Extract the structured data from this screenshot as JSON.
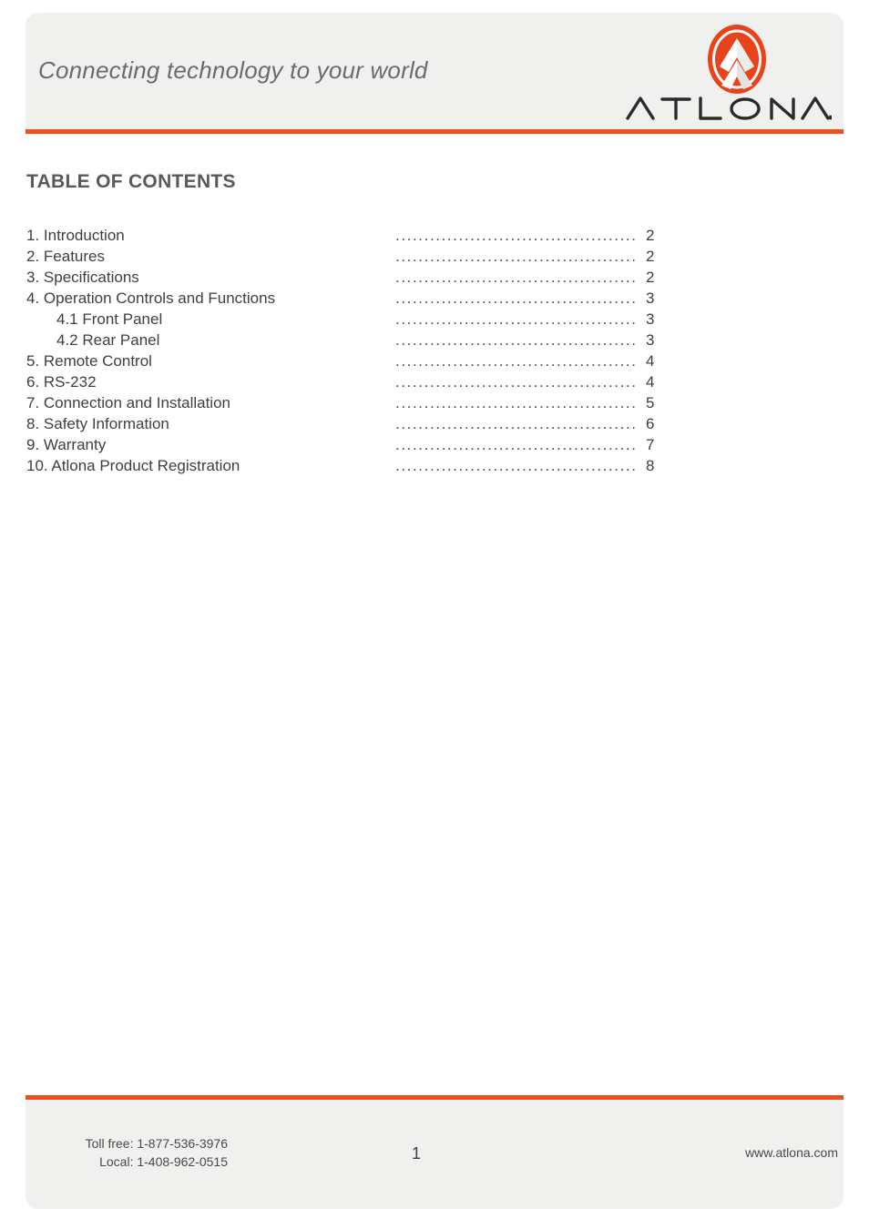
{
  "header": {
    "tagline": "Connecting technology to your world",
    "logo": {
      "mark_name": "atlona-chevron-logo",
      "wordmark": "ATLONA.",
      "brand_color": "#ef4e1d"
    }
  },
  "toc": {
    "title": "TABLE OF CONTENTS",
    "leader": "...............................................",
    "entries": [
      {
        "label": "1. Introduction",
        "page": "2",
        "indent": false
      },
      {
        "label": "2. Features",
        "page": "2",
        "indent": false
      },
      {
        "label": "3. Specifications",
        "page": "2",
        "indent": false
      },
      {
        "label": "4. Operation Controls and Functions",
        "page": "3",
        "indent": false
      },
      {
        "label": "4.1 Front Panel",
        "page": "3",
        "indent": true
      },
      {
        "label": "4.2 Rear Panel",
        "page": "3",
        "indent": true
      },
      {
        "label": "5. Remote Control",
        "page": "4",
        "indent": false
      },
      {
        "label": "6. RS-232",
        "page": "4",
        "indent": false
      },
      {
        "label": "7. Connection and Installation",
        "page": "5",
        "indent": false
      },
      {
        "label": "8. Safety Information",
        "page": "6",
        "indent": false
      },
      {
        "label": "9. Warranty",
        "page": "7",
        "indent": false
      },
      {
        "label": "10. Atlona Product Registration",
        "page": "8",
        "indent": false
      }
    ]
  },
  "footer": {
    "toll_free": "Toll free: 1-877-536-3976",
    "local": "Local: 1-408-962-0515",
    "page_number": "1",
    "website": "www.atlona.com"
  }
}
